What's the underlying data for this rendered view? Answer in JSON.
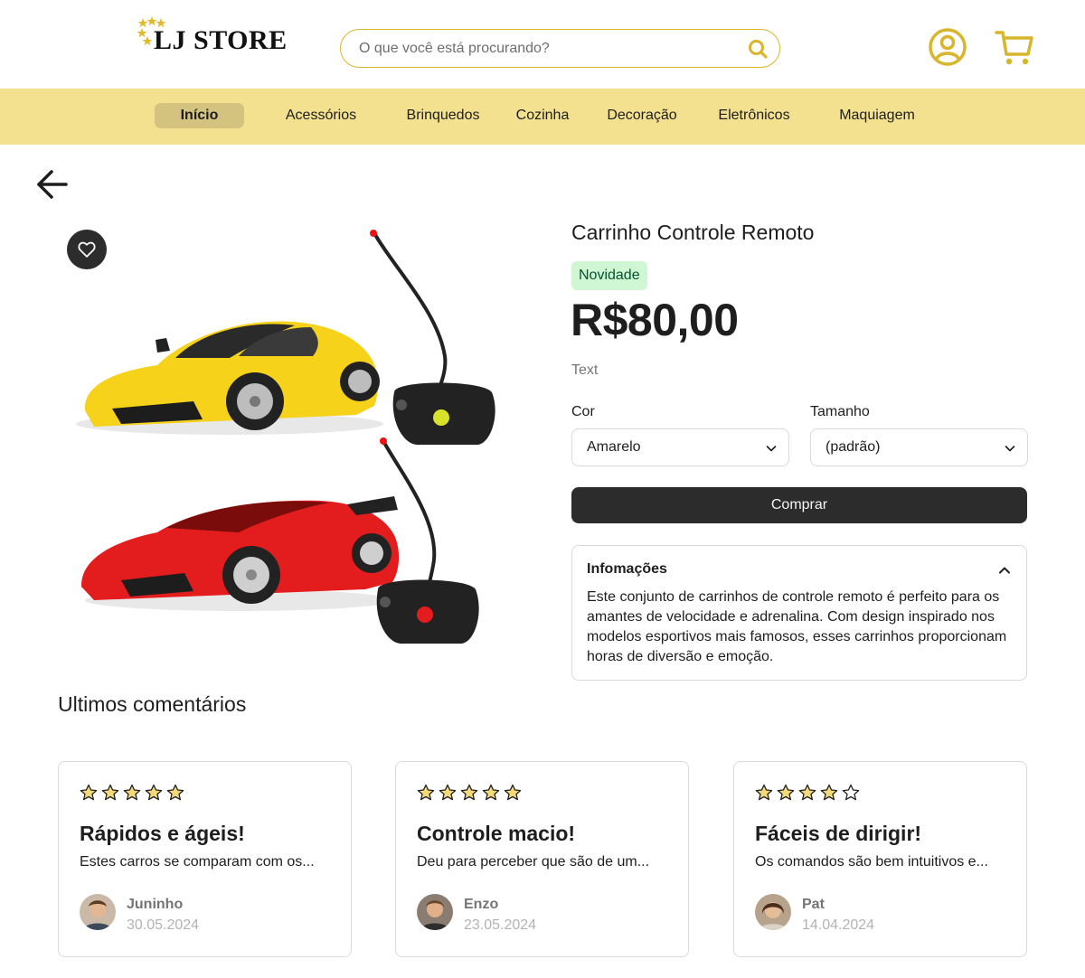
{
  "header": {
    "logo_text": "LJ STORE",
    "search_placeholder": "O que você está procurando?",
    "accent_color": "#d9b52c"
  },
  "nav": {
    "items": [
      {
        "label": "Início",
        "active": true
      },
      {
        "label": "Acessórios"
      },
      {
        "label": "Brinquedos"
      },
      {
        "label": "Cozinha"
      },
      {
        "label": "Decoração"
      },
      {
        "label": "Eletrônicos"
      },
      {
        "label": "Maquiagem"
      }
    ],
    "background": "#f3e18f"
  },
  "product": {
    "title": "Carrinho Controle Remoto",
    "badge": "Novidade",
    "price": "R$80,00",
    "description_placeholder": "Text",
    "color_label": "Cor",
    "color_value": "Amarelo",
    "size_label": "Tamanho",
    "size_value": "(padrão)",
    "buy_label": "Comprar",
    "info_title": "Infomações",
    "info_body": "Este conjunto de carrinhos de controle remoto é perfeito para os amantes de velocidade e adrenalina. Com design inspirado nos modelos esportivos mais famosos, esses carrinhos proporcionam horas de diversão e emoção."
  },
  "reviews": {
    "section_title": "Ultimos comentários",
    "items": [
      {
        "rating": 5,
        "title": "Rápidos e ágeis!",
        "body": "Estes carros se comparam com os...",
        "name": "Juninho",
        "date": "30.05.2024"
      },
      {
        "rating": 5,
        "title": "Controle macio!",
        "body": "Deu para perceber que são de um...",
        "name": "Enzo",
        "date": "23.05.2024"
      },
      {
        "rating": 4,
        "title": "Fáceis de dirigir!",
        "body": "Os comandos são bem intuitivos e...",
        "name": "Pat",
        "date": "14.04.2024"
      }
    ]
  }
}
